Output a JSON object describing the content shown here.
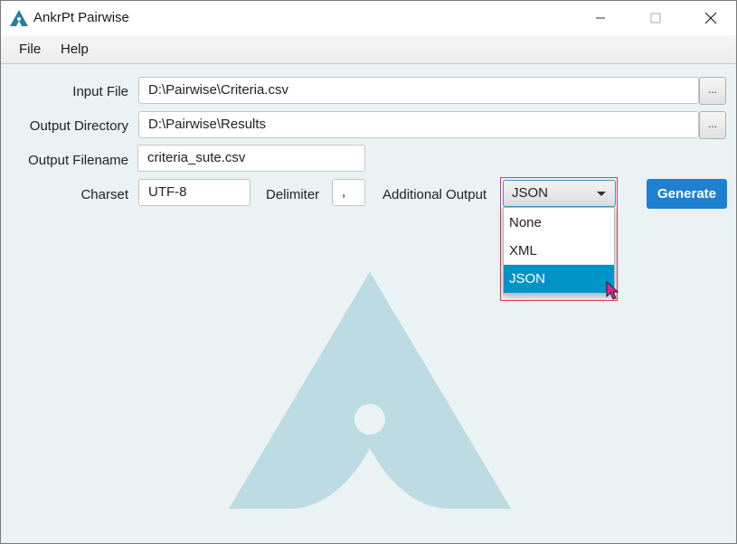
{
  "window": {
    "title": "AnkrPt Pairwise"
  },
  "menu": [
    "File",
    "Help"
  ],
  "form": {
    "input_file": {
      "label": "Input File",
      "value": "D:\\Pairwise\\Criteria.csv",
      "browse_label": "..."
    },
    "output_directory": {
      "label": "Output Directory",
      "value": "D:\\Pairwise\\Results",
      "browse_label": "..."
    },
    "output_filename": {
      "label": "Output Filename",
      "value": "criteria_sute.csv"
    },
    "charset": {
      "label": "Charset",
      "value": "UTF-8"
    },
    "delimiter": {
      "label": "Delimiter",
      "value": ","
    },
    "additional_output": {
      "label": "Additional Output",
      "selected": "JSON",
      "options": [
        "None",
        "XML",
        "JSON"
      ],
      "highlighted_option": "JSON"
    },
    "generate_label": "Generate"
  },
  "colors": {
    "accent": "#1f80cf",
    "selection": "#0093c7",
    "logo_watermark": "#bcdbe2",
    "highlight_border": "#e33a55",
    "background": "#eaf2f4"
  }
}
